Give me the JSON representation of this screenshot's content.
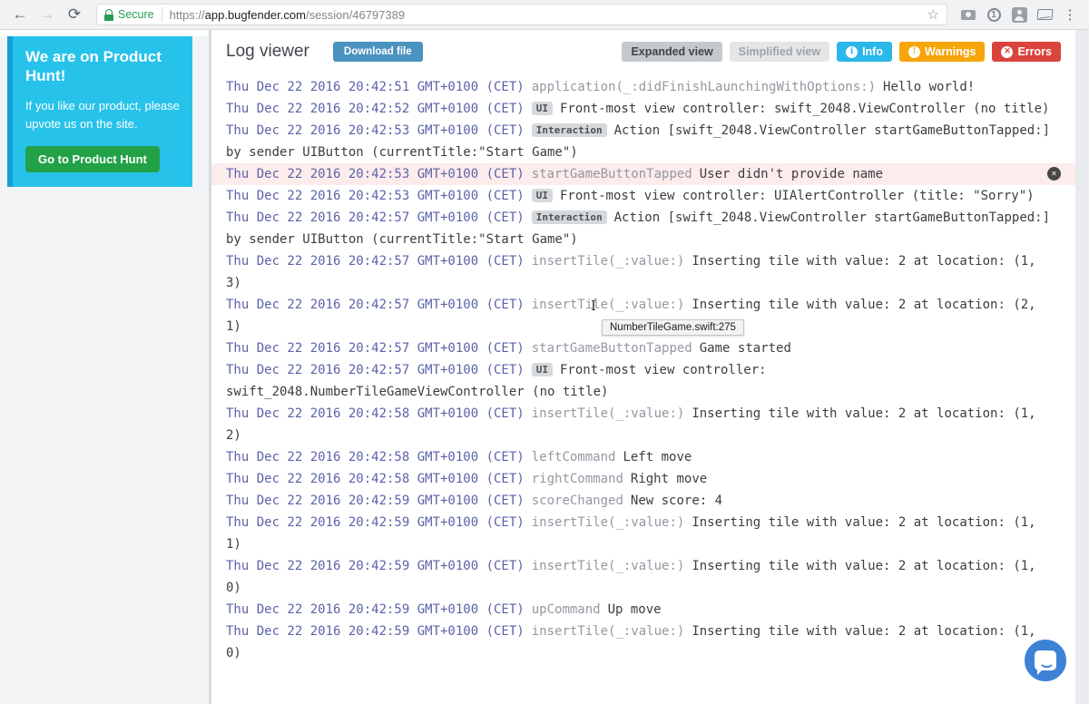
{
  "browser": {
    "back_icon": "←",
    "forward_icon": "→",
    "reload_icon": "⟳",
    "secure_label": "Secure",
    "url_scheme": "https://",
    "url_host": "app.bugfender.com",
    "url_path": "/session/46797389",
    "star_icon": "☆",
    "menu_icon": "⋮",
    "extension_one_glyph": "1"
  },
  "promo": {
    "title": "We are on Product Hunt!",
    "body": "If you like our product, please upvote us on the site.",
    "button_label": "Go to Product Hunt",
    "bg_color": "#27c2ea",
    "button_color": "#22a146"
  },
  "header": {
    "title": "Log viewer",
    "download_label": "Download file",
    "expanded_label": "Expanded view",
    "simplified_label": "Simplified view",
    "info_label": "Info",
    "warnings_label": "Warnings",
    "errors_label": "Errors",
    "info_color": "#2ab7e9",
    "warnings_color": "#f6a50b",
    "errors_color": "#d9443c",
    "info_icon_glyph": "i",
    "warnings_icon_glyph": "!",
    "errors_icon_glyph": "✕"
  },
  "tooltip_text": "NumberTileGame.swift:275",
  "error_dismiss_glyph": "✕",
  "log": {
    "rows": [
      {
        "time": "Thu Dec 22 2016 20:42:51 GMT+0100 (CET)",
        "badge": null,
        "tag": "application(_:didFinishLaunchingWithOptions:)",
        "message": "Hello world!",
        "error": false
      },
      {
        "time": "Thu Dec 22 2016 20:42:52 GMT+0100 (CET)",
        "badge": "UI",
        "tag": null,
        "message": "Front-most view controller: swift_2048.ViewController (no title)",
        "error": false
      },
      {
        "time": "Thu Dec 22 2016 20:42:53 GMT+0100 (CET)",
        "badge": "Interaction",
        "tag": null,
        "message": "Action [swift_2048.ViewController startGameButtonTapped:] by sender UIButton (currentTitle:\"Start Game\")",
        "error": false
      },
      {
        "time": "Thu Dec 22 2016 20:42:53 GMT+0100 (CET)",
        "badge": null,
        "tag": "startGameButtonTapped",
        "message": "User didn't provide name",
        "error": true
      },
      {
        "time": "Thu Dec 22 2016 20:42:53 GMT+0100 (CET)",
        "badge": "UI",
        "tag": null,
        "message": "Front-most view controller: UIAlertController (title: \"Sorry\")",
        "error": false
      },
      {
        "time": "Thu Dec 22 2016 20:42:57 GMT+0100 (CET)",
        "badge": "Interaction",
        "tag": null,
        "message": "Action [swift_2048.ViewController startGameButtonTapped:] by sender UIButton (currentTitle:\"Start Game\")",
        "error": false
      },
      {
        "time": "Thu Dec 22 2016 20:42:57 GMT+0100 (CET)",
        "badge": null,
        "tag": "insertTile(_:value:)",
        "message": "Inserting tile with value: 2 at location: (1, 3)",
        "error": false
      },
      {
        "time": "Thu Dec 22 2016 20:42:57 GMT+0100 (CET)",
        "badge": null,
        "tag": "insertTile(_:value:)",
        "message": "Inserting tile with value: 2 at location: (2, 1)",
        "error": false
      },
      {
        "time": "Thu Dec 22 2016 20:42:57 GMT+0100 (CET)",
        "badge": null,
        "tag": "startGameButtonTapped",
        "message": "Game started",
        "error": false
      },
      {
        "time": "Thu Dec 22 2016 20:42:57 GMT+0100 (CET)",
        "badge": "UI",
        "tag": null,
        "message": "Front-most view controller: swift_2048.NumberTileGameViewController (no title)",
        "error": false
      },
      {
        "time": "Thu Dec 22 2016 20:42:58 GMT+0100 (CET)",
        "badge": null,
        "tag": "insertTile(_:value:)",
        "message": "Inserting tile with value: 2 at location: (1, 2)",
        "error": false
      },
      {
        "time": "Thu Dec 22 2016 20:42:58 GMT+0100 (CET)",
        "badge": null,
        "tag": "leftCommand",
        "message": "Left move",
        "error": false
      },
      {
        "time": "Thu Dec 22 2016 20:42:58 GMT+0100 (CET)",
        "badge": null,
        "tag": "rightCommand",
        "message": "Right move",
        "error": false
      },
      {
        "time": "Thu Dec 22 2016 20:42:59 GMT+0100 (CET)",
        "badge": null,
        "tag": "scoreChanged",
        "message": "New score: 4",
        "error": false
      },
      {
        "time": "Thu Dec 22 2016 20:42:59 GMT+0100 (CET)",
        "badge": null,
        "tag": "insertTile(_:value:)",
        "message": "Inserting tile with value: 2 at location: (1, 1)",
        "error": false
      },
      {
        "time": "Thu Dec 22 2016 20:42:59 GMT+0100 (CET)",
        "badge": null,
        "tag": "insertTile(_:value:)",
        "message": "Inserting tile with value: 2 at location: (1, 0)",
        "error": false
      },
      {
        "time": "Thu Dec 22 2016 20:42:59 GMT+0100 (CET)",
        "badge": null,
        "tag": "upCommand",
        "message": "Up move",
        "error": false
      },
      {
        "time": "Thu Dec 22 2016 20:42:59 GMT+0100 (CET)",
        "badge": null,
        "tag": "insertTile(_:value:)",
        "message": "Inserting tile with value: 2 at location: (1, 0)",
        "error": false
      }
    ]
  }
}
